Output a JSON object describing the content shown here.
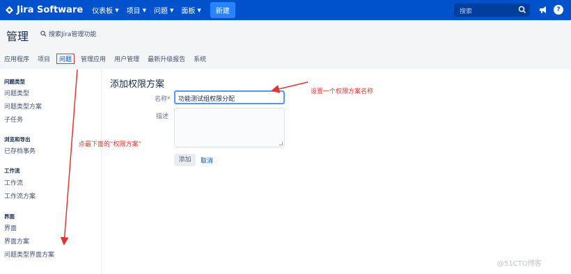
{
  "topnav": {
    "logo_text": "Jira Software",
    "items": [
      "仪表板",
      "项目",
      "问题",
      "面板"
    ],
    "create_label": "新建",
    "search_placeholder": "搜索",
    "brand_color": "#0052cc"
  },
  "header": {
    "title": "管理",
    "admin_search": "搜索Jira管理功能",
    "tabs": [
      "应用程序",
      "项目",
      "问题",
      "管理应用",
      "用户管理",
      "最新升级报告",
      "系统"
    ],
    "active_tab": "问题"
  },
  "sidebar": {
    "groups": [
      {
        "title": "问题类型",
        "items": [
          "问题类型",
          "问题类型方案",
          "子任务"
        ]
      },
      {
        "title": "浏览和导出",
        "items": [
          "已存档事务"
        ]
      },
      {
        "title": "工作流",
        "items": [
          "工作流",
          "工作流方案"
        ]
      },
      {
        "title": "界面",
        "items": [
          "界面",
          "界面方案",
          "问题类型界面方案"
        ]
      }
    ]
  },
  "form": {
    "title": "添加权限方案",
    "name_label": "名称*",
    "name_value": "功能测试组权限分配",
    "desc_label": "描述",
    "add_label": "添加",
    "cancel_label": "取消"
  },
  "annotations": {
    "name_note": "设置一个权限方案名称",
    "sidebar_note": "点最下面的“权限方案”"
  },
  "watermark": "@51CTO博客"
}
